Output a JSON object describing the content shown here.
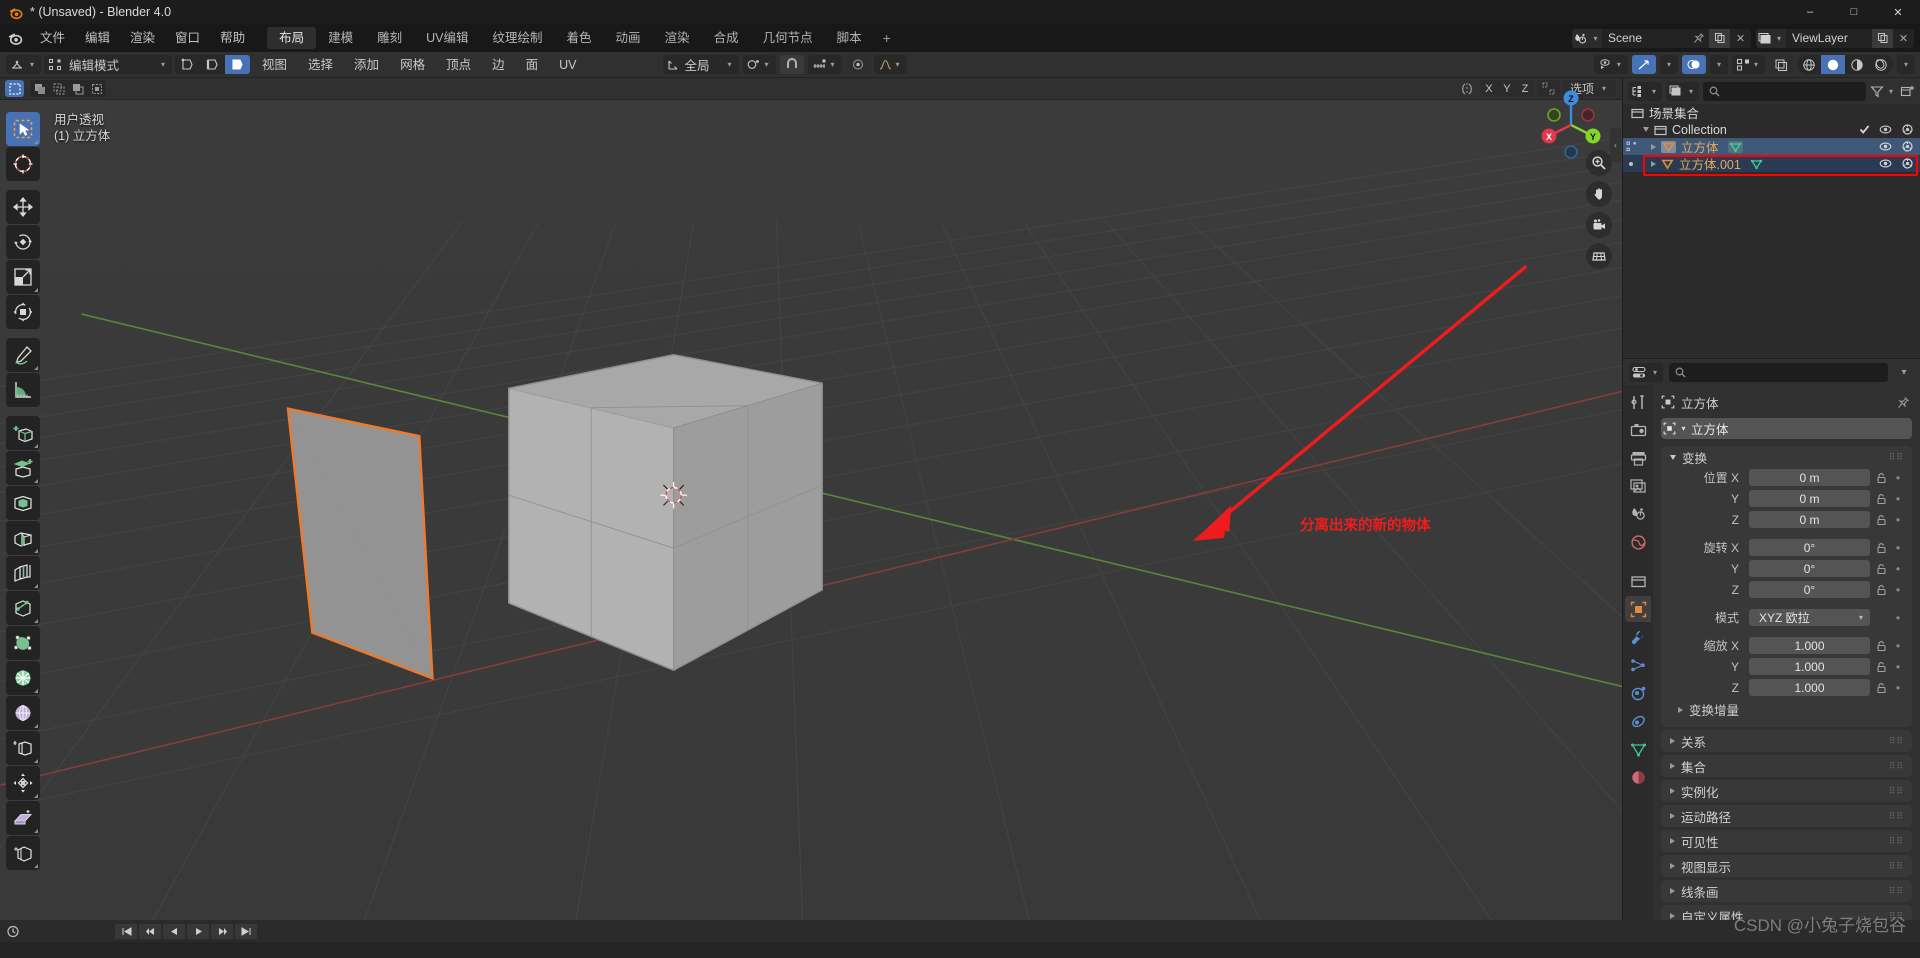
{
  "window": {
    "title": "* (Unsaved) - Blender 4.0",
    "minimize": "–",
    "maximize": "□",
    "close": "✕"
  },
  "topbar": {
    "menus": [
      "文件",
      "编辑",
      "渲染",
      "窗口",
      "帮助"
    ],
    "workspaces": [
      {
        "label": "布局",
        "active": true
      },
      {
        "label": "建模",
        "active": false
      },
      {
        "label": "雕刻",
        "active": false
      },
      {
        "label": "UV编辑",
        "active": false
      },
      {
        "label": "纹理绘制",
        "active": false
      },
      {
        "label": "着色",
        "active": false
      },
      {
        "label": "动画",
        "active": false
      },
      {
        "label": "渲染",
        "active": false
      },
      {
        "label": "合成",
        "active": false
      },
      {
        "label": "几何节点",
        "active": false
      },
      {
        "label": "脚本",
        "active": false
      }
    ],
    "add_workspace": "+",
    "scene": {
      "name": "Scene",
      "icon": "scene-icon"
    },
    "view_layer": {
      "name": "ViewLayer",
      "icon": "viewlayer-icon"
    }
  },
  "viewport_header": {
    "mode": "编辑模式",
    "mode_icon": "editmode-icon",
    "select_modes": [
      {
        "name": "vertex-select",
        "active": false
      },
      {
        "name": "edge-select",
        "active": false
      },
      {
        "name": "face-select",
        "active": true
      }
    ],
    "menus": [
      "视图",
      "选择",
      "添加",
      "网格",
      "顶点",
      "边",
      "面",
      "UV"
    ],
    "transform_orientation": "全局",
    "snap_icon": "magnet-icon",
    "proportional_icon": "proportional-icon",
    "overlays_icon": "overlays-icon",
    "xray_icon": "xray-icon",
    "gizmo_icon": "gizmo-icon",
    "shading_modes": [
      {
        "name": "wireframe-shading",
        "active": false
      },
      {
        "name": "solid-shading",
        "active": true
      },
      {
        "name": "material-shading",
        "active": false
      },
      {
        "name": "rendered-shading",
        "active": false
      }
    ]
  },
  "viewport_submode": {
    "select_tools": [
      "select-box",
      "select-circle",
      "select-lasso",
      "select-tweak",
      "select-extend"
    ],
    "axis_locks": [
      "X",
      "Y",
      "Z"
    ],
    "mirror_icon": "mirror-icon",
    "options_label": "选项"
  },
  "viewport": {
    "overlay_line1": "用户透视",
    "overlay_line2": "(1) 立方体",
    "annotation": "分离出来的新的物体",
    "annotation_color": "#ee1c1c",
    "gizmo_axes": [
      {
        "label": "Z",
        "color": "#3d8ce0"
      },
      {
        "label": "X",
        "color": "#e0384f"
      },
      {
        "label": "Y",
        "color": "#84d62b"
      }
    ],
    "nav_buttons": [
      "zoom-icon",
      "pan-icon",
      "camera-icon",
      "ortho-persp-icon"
    ],
    "collapse_arrow": "‹"
  },
  "toolbar": {
    "tools": [
      {
        "name": "tweak-tool",
        "active": true
      },
      {
        "name": "cursor-tool",
        "active": false
      },
      {
        "name": "move-tool",
        "active": false
      },
      {
        "name": "rotate-tool",
        "active": false
      },
      {
        "name": "scale-tool",
        "active": false
      },
      {
        "name": "transform-tool",
        "active": false
      },
      {
        "name": "annotate-tool",
        "active": false
      },
      {
        "name": "measure-tool",
        "active": false
      },
      {
        "name": "add-cube-tool",
        "active": false
      },
      {
        "name": "extrude-region-tool",
        "active": false
      },
      {
        "name": "inset-faces-tool",
        "active": false
      },
      {
        "name": "bevel-tool",
        "active": false
      },
      {
        "name": "loop-cut-tool",
        "active": false
      },
      {
        "name": "knife-tool",
        "active": false
      },
      {
        "name": "poly-build-tool",
        "active": false
      },
      {
        "name": "spin-tool",
        "active": false
      },
      {
        "name": "smooth-tool",
        "active": false
      },
      {
        "name": "edge-slide-tool",
        "active": false
      },
      {
        "name": "shrink-fatten-tool",
        "active": false
      },
      {
        "name": "shear-tool",
        "active": false
      },
      {
        "name": "rip-region-tool",
        "active": false
      }
    ]
  },
  "outliner": {
    "display_mode_icon": "outliner-view-icon",
    "filter_icon": "filter-icon",
    "new_collection_icon": "new-collection-icon",
    "search_placeholder": "",
    "scene_collection": "场景集合",
    "rows": [
      {
        "label": "Collection",
        "indent": 1,
        "type": "collection",
        "expanded": true,
        "selected": false,
        "has_checkbox": true,
        "icons": [
          "eye-icon",
          "camera-icon"
        ]
      },
      {
        "label": "立方体",
        "indent": 2,
        "type": "object",
        "expanded": false,
        "selected": true,
        "has_checkbox": false,
        "mesh_icon": "mesh-data-icon",
        "icons": [
          "eye-icon",
          "camera-icon"
        ]
      },
      {
        "label": "立方体.001",
        "indent": 2,
        "type": "object",
        "expanded": false,
        "selected": false,
        "highlighted": true,
        "has_checkbox": false,
        "mesh_icon": "mesh-data-icon",
        "icons": [
          "eye-icon",
          "camera-icon"
        ]
      }
    ]
  },
  "properties": {
    "editor_icon": "properties-editor-icon",
    "search_placeholder": "",
    "breadcrumb": "立方体",
    "breadcrumb_icon": "object-icon",
    "pin_icon": "pin-icon",
    "id_name": "立方体",
    "tabs": [
      {
        "name": "tool-tab",
        "active": false,
        "color": "#b4b4b4"
      },
      {
        "name": "render-tab",
        "active": false,
        "color": "#b4b4b4"
      },
      {
        "name": "output-tab",
        "active": false,
        "color": "#b4b4b4"
      },
      {
        "name": "view-layer-tab",
        "active": false,
        "color": "#b4b4b4"
      },
      {
        "name": "scene-tab",
        "active": false,
        "color": "#b4b4b4"
      },
      {
        "name": "world-tab",
        "active": false,
        "color": "#d66a6a"
      },
      {
        "name": "collection-tab",
        "active": false,
        "color": "#b4b4b4"
      },
      {
        "name": "object-tab",
        "active": true,
        "color": "#e08c3c"
      },
      {
        "name": "modifiers-tab",
        "active": false,
        "color": "#5b8fd6"
      },
      {
        "name": "particles-tab",
        "active": false,
        "color": "#5b8fd6"
      },
      {
        "name": "physics-tab",
        "active": false,
        "color": "#5b8fd6"
      },
      {
        "name": "constraints-tab",
        "active": false,
        "color": "#5b8fd6"
      },
      {
        "name": "data-tab",
        "active": false,
        "color": "#3cc98f"
      },
      {
        "name": "material-tab",
        "active": false,
        "color": "#d06b75"
      }
    ],
    "transform_panel": {
      "title": "变换",
      "expanded": true,
      "location_label": "位置",
      "rotation_label": "旋转",
      "scale_label": "缩放",
      "mode_label": "模式",
      "location": [
        {
          "axis": "X",
          "value": "0 m"
        },
        {
          "axis": "Y",
          "value": "0 m"
        },
        {
          "axis": "Z",
          "value": "0 m"
        }
      ],
      "rotation": [
        {
          "axis": "X",
          "value": "0°"
        },
        {
          "axis": "Y",
          "value": "0°"
        },
        {
          "axis": "Z",
          "value": "0°"
        }
      ],
      "rotation_mode": "XYZ 欧拉",
      "scale": [
        {
          "axis": "X",
          "value": "1.000"
        },
        {
          "axis": "Y",
          "value": "1.000"
        },
        {
          "axis": "Z",
          "value": "1.000"
        }
      ],
      "delta_transform": "变换增量"
    },
    "collapsed_panels": [
      "关系",
      "集合",
      "实例化",
      "运动路径",
      "可见性",
      "视图显示",
      "线条画",
      "自定义属性"
    ]
  },
  "watermark": "CSDN @小兔子烧包谷"
}
